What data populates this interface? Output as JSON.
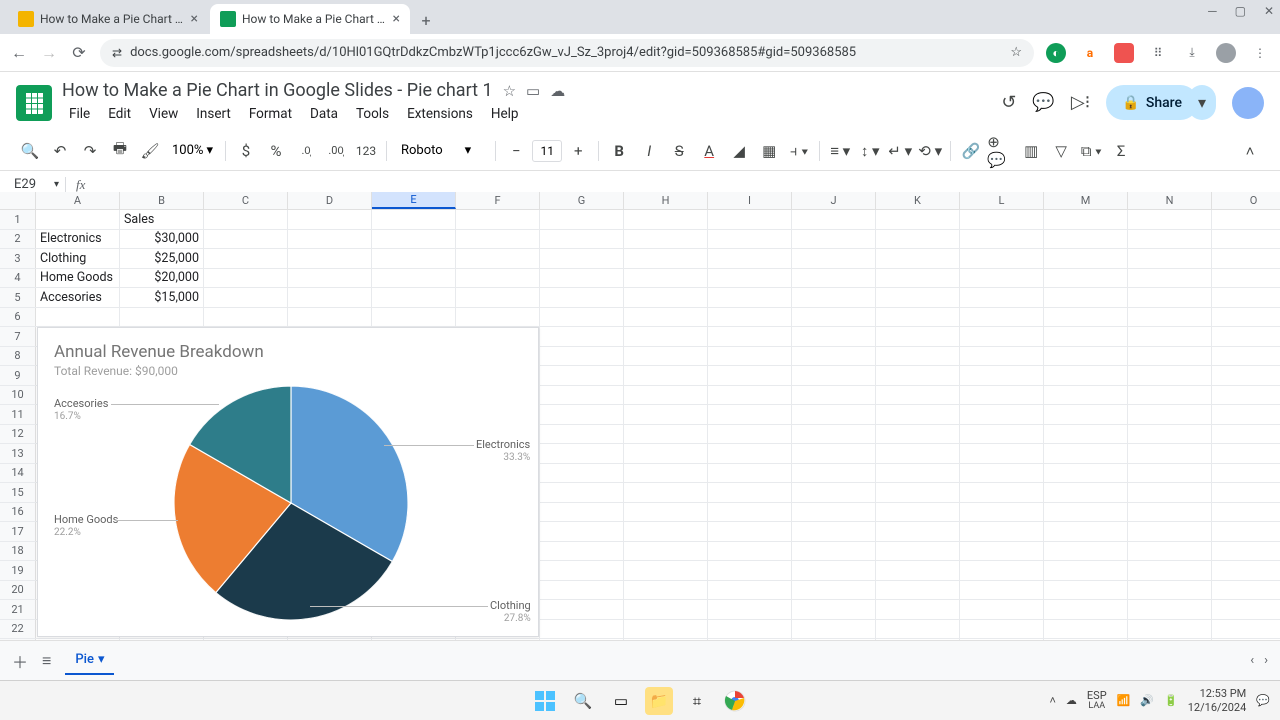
{
  "browser": {
    "tabs": [
      {
        "title": "How to Make a Pie Chart in Go…",
        "active": false,
        "favicon": "slides"
      },
      {
        "title": "How to Make a Pie Chart in Go…",
        "active": true,
        "favicon": "sheets"
      }
    ],
    "url": "docs.google.com/spreadsheets/d/10Hl01GQtrDdkzCmbzWTp1jccc6zGw_vJ_Sz_3proj4/edit?gid=509368585#gid=509368585"
  },
  "doc": {
    "title": "How to Make a Pie Chart in Google Slides - Pie chart 1",
    "menu": [
      "File",
      "Edit",
      "View",
      "Insert",
      "Format",
      "Data",
      "Tools",
      "Extensions",
      "Help"
    ],
    "share_label": "Share",
    "zoom": "100%",
    "font_name": "Roboto",
    "font_size": "11",
    "name_box": "E29",
    "active_sheet": "Pie"
  },
  "columns": [
    "A",
    "B",
    "C",
    "D",
    "E",
    "F",
    "G",
    "H",
    "I",
    "J",
    "K",
    "L",
    "M",
    "N",
    "O"
  ],
  "selected_column_index": 4,
  "sheet_data": {
    "header_row": {
      "B": "Sales"
    },
    "rows": [
      {
        "A": "Electronics",
        "B": "$30,000"
      },
      {
        "A": "Clothing",
        "B": "$25,000"
      },
      {
        "A": "Home Goods",
        "B": "$20,000"
      },
      {
        "A": "Accesories",
        "B": "$15,000"
      }
    ]
  },
  "chart_data": {
    "type": "pie",
    "title": "Annual Revenue Breakdown",
    "subtitle": "Total Revenue: $90,000",
    "series": [
      {
        "name": "Electronics",
        "value": 30000,
        "pct": "33.3%",
        "color": "#5b9bd5"
      },
      {
        "name": "Clothing",
        "value": 25000,
        "pct": "27.8%",
        "color": "#1b3a4b"
      },
      {
        "name": "Home Goods",
        "value": 20000,
        "pct": "22.2%",
        "color": "#ed7d31"
      },
      {
        "name": "Accesories",
        "value": 15000,
        "pct": "16.7%",
        "color": "#2e7d8a"
      }
    ]
  },
  "taskbar": {
    "lang": "ESP",
    "region": "LAA",
    "time": "12:53 PM",
    "date": "12/16/2024"
  }
}
